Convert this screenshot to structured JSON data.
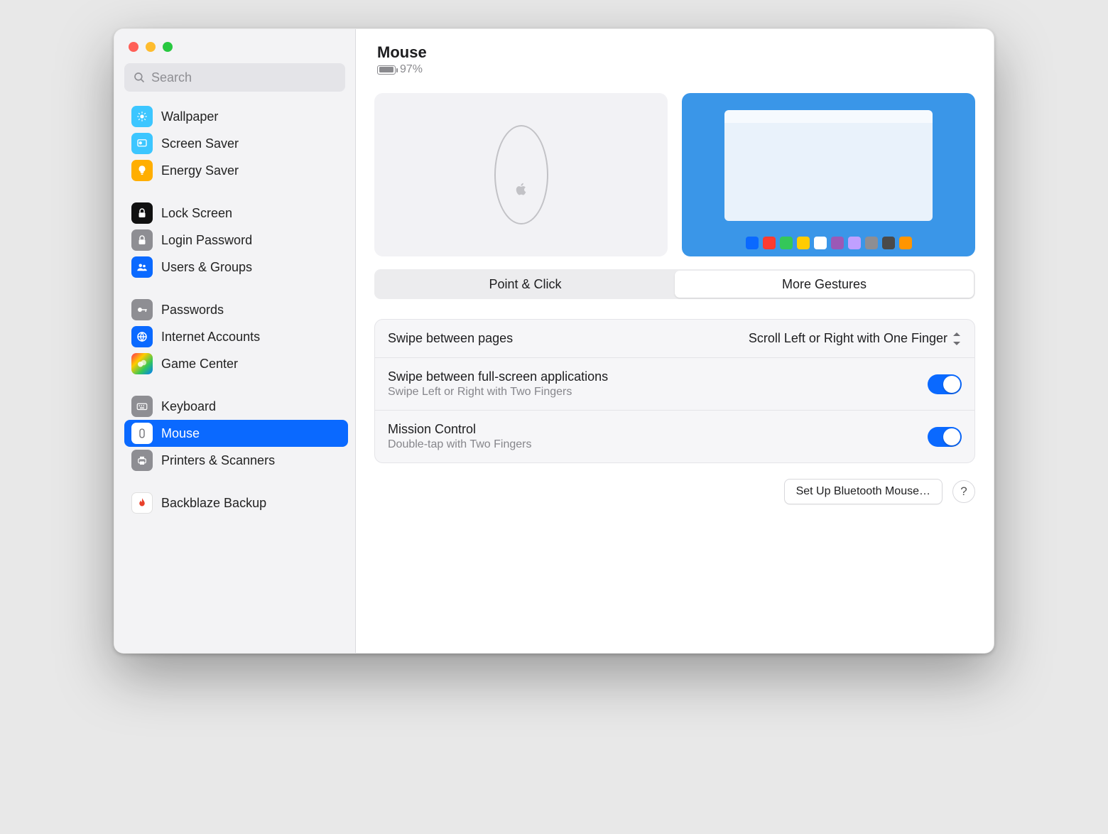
{
  "search": {
    "placeholder": "Search"
  },
  "sidebar": {
    "groups": [
      [
        {
          "id": "wallpaper",
          "label": "Wallpaper"
        },
        {
          "id": "screensaver",
          "label": "Screen Saver"
        },
        {
          "id": "energy",
          "label": "Energy Saver"
        }
      ],
      [
        {
          "id": "lockscreen",
          "label": "Lock Screen"
        },
        {
          "id": "login",
          "label": "Login Password"
        },
        {
          "id": "users",
          "label": "Users & Groups"
        }
      ],
      [
        {
          "id": "passwords",
          "label": "Passwords"
        },
        {
          "id": "internet",
          "label": "Internet Accounts"
        },
        {
          "id": "gamecenter",
          "label": "Game Center"
        }
      ],
      [
        {
          "id": "keyboard",
          "label": "Keyboard"
        },
        {
          "id": "mouse",
          "label": "Mouse",
          "selected": true
        },
        {
          "id": "printers",
          "label": "Printers & Scanners"
        }
      ],
      [
        {
          "id": "backblaze",
          "label": "Backblaze Backup"
        }
      ]
    ]
  },
  "header": {
    "title": "Mouse",
    "battery_percent": "97%"
  },
  "tabs": {
    "point_click": "Point & Click",
    "more_gestures": "More Gestures",
    "active": "more_gestures"
  },
  "settings": {
    "swipe_pages": {
      "title": "Swipe between pages",
      "value": "Scroll Left or Right with One Finger"
    },
    "swipe_fullscreen": {
      "title": "Swipe between full-screen applications",
      "sub": "Swipe Left or Right with Two Fingers",
      "on": true
    },
    "mission_control": {
      "title": "Mission Control",
      "sub": "Double-tap with Two Fingers",
      "on": true
    }
  },
  "footer": {
    "setup_button": "Set Up Bluetooth Mouse…",
    "help": "?"
  },
  "dock_colors": [
    "#0a69ff",
    "#ff3b30",
    "#34c759",
    "#ffcc00",
    "#ffffff",
    "#9b59b6",
    "#c0a0ff",
    "#8e8e93",
    "#4a4a4a",
    "#ff9500"
  ]
}
